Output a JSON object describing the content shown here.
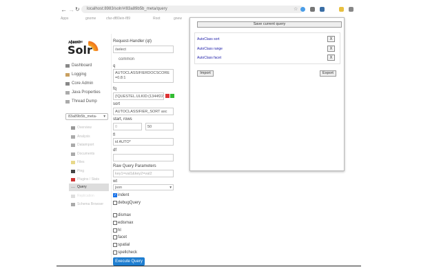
{
  "browser": {
    "url": "localhost:8983/solr/#/83a89b5b_meta/query",
    "bookmarks": [
      "Apps",
      "gnome",
      "cfar-df80ein-f89",
      "Root",
      "gnew"
    ]
  },
  "sidebar": {
    "logo_top": "Apache",
    "logo_main": "Solr",
    "items": [
      {
        "label": "Dashboard"
      },
      {
        "label": "Logging"
      },
      {
        "label": "Core Admin"
      },
      {
        "label": "Java Properties"
      },
      {
        "label": "Thread Dump"
      }
    ],
    "core_selector": "83a89b5b_meta-",
    "core_items": [
      {
        "label": "Overview"
      },
      {
        "label": "Analysis"
      },
      {
        "label": "Dataimport"
      },
      {
        "label": "Documents"
      },
      {
        "label": "Files"
      },
      {
        "label": "Ping"
      },
      {
        "label": "Plugins / Stats"
      },
      {
        "label": "Query"
      },
      {
        "label": "Replication"
      },
      {
        "label": "Schema Browser"
      }
    ]
  },
  "form": {
    "request_handler_label": "Request-Handler (qt)",
    "request_handler": "/select",
    "common_label": "common",
    "q_label": "q",
    "q": "AUTOCLASSIFIERDOCSCORE=0.8:1",
    "fq_label": "fq",
    "fq": "{!QUESTEL.ULKID:(1344f229-",
    "sort_label": "sort",
    "sort": "AUTOCLASSIFIER_SORT asc",
    "start_rows_label": "start, rows",
    "start": "0",
    "rows": "50",
    "fl_label": "fl",
    "fl": "id AUTO*",
    "df_label": "df",
    "df": "",
    "raw_label": "Raw Query Parameters",
    "raw_placeholder": "key1=val1&key2=val2",
    "wt_label": "wt",
    "wt": "json",
    "indent_label": "indent",
    "indent": true,
    "debug_label": "debugQuery",
    "debug": false,
    "options": [
      {
        "label": "dismax"
      },
      {
        "label": "edismax"
      },
      {
        "label": "hl"
      },
      {
        "label": "facet"
      },
      {
        "label": "spatial"
      },
      {
        "label": "spellcheck"
      }
    ],
    "execute_label": "Execute Query"
  },
  "popup": {
    "save_label": "Save current query",
    "queries": [
      {
        "name": "AutoClass sort"
      },
      {
        "name": "AutoClass range"
      },
      {
        "name": "AutoClass facet"
      }
    ],
    "remove_label": "X",
    "import_label": "Import",
    "export_label": "Export"
  },
  "colors": {
    "accent": "#1a73e8",
    "execute": "#1f7ed0",
    "link": "#2222aa"
  }
}
